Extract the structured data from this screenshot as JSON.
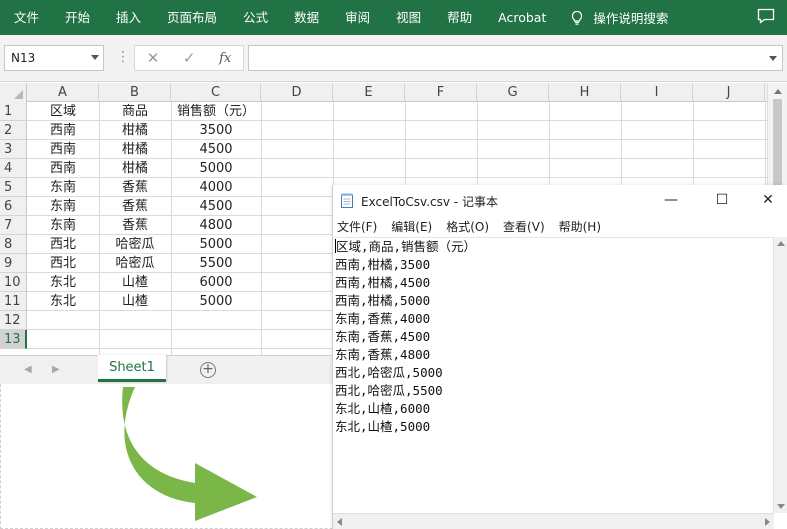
{
  "ribbon": {
    "tabs": [
      "文件",
      "开始",
      "插入",
      "页面布局",
      "公式",
      "数据",
      "审阅",
      "视图",
      "帮助",
      "Acrobat"
    ],
    "tell_me": "操作说明搜索",
    "bg_color": "#217346"
  },
  "formula_bar": {
    "name_box": "N13",
    "fx_label": "fx",
    "cancel_icon": "x-icon",
    "enter_icon": "check-icon",
    "value": ""
  },
  "sheet": {
    "columns": [
      "A",
      "B",
      "C",
      "D",
      "E",
      "F",
      "G",
      "H",
      "I",
      "J"
    ],
    "row_numbers": [
      "1",
      "2",
      "3",
      "4",
      "5",
      "6",
      "7",
      "8",
      "9",
      "10",
      "11",
      "12",
      "13"
    ],
    "selected_row": "13",
    "rows": [
      [
        "区域",
        "商品",
        "销售额（元）"
      ],
      [
        "西南",
        "柑橘",
        "3500"
      ],
      [
        "西南",
        "柑橘",
        "4500"
      ],
      [
        "西南",
        "柑橘",
        "5000"
      ],
      [
        "东南",
        "香蕉",
        "4000"
      ],
      [
        "东南",
        "香蕉",
        "4500"
      ],
      [
        "东南",
        "香蕉",
        "4800"
      ],
      [
        "西北",
        "哈密瓜",
        "5000"
      ],
      [
        "西北",
        "哈密瓜",
        "5500"
      ],
      [
        "东北",
        "山楂",
        "6000"
      ],
      [
        "东北",
        "山楂",
        "5000"
      ]
    ],
    "tab_name": "Sheet1",
    "add_sheet": "+"
  },
  "arrow": {
    "color": "#7ab648"
  },
  "notepad": {
    "title": "ExcelToCsv.csv - 记事本",
    "minimize": "—",
    "maximize": "☐",
    "close": "✕",
    "menu": [
      "文件(F)",
      "编辑(E)",
      "格式(O)",
      "查看(V)",
      "帮助(H)"
    ],
    "lines": [
      "区域,商品,销售额（元）",
      "西南,柑橘,3500",
      "西南,柑橘,4500",
      "西南,柑橘,5000",
      "东南,香蕉,4000",
      "东南,香蕉,4500",
      "东南,香蕉,4800",
      "西北,哈密瓜,5000",
      "西北,哈密瓜,5500",
      "东北,山楂,6000",
      "东北,山楂,5000"
    ]
  }
}
